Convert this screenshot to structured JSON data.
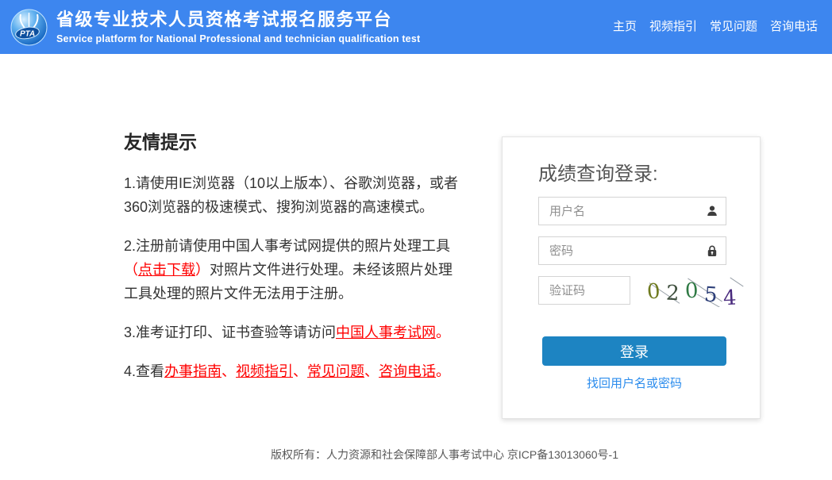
{
  "header": {
    "logo": "PTA",
    "title_cn": "省级专业技术人员资格考试报名服务平台",
    "title_en": "Service platform for National Professional and technician qualification test",
    "nav": [
      {
        "label": "主页"
      },
      {
        "label": "视频指引"
      },
      {
        "label": "常见问题"
      },
      {
        "label": "咨询电话"
      }
    ]
  },
  "tips": {
    "heading": "友情提示",
    "tip1": "1.请使用IE浏览器（10以上版本）、谷歌浏览器，或者360浏览器的极速模式、搜狗浏览器的高速模式。",
    "tip2": {
      "pre": "2.注册前请使用中国人事考试网提供的照片处理工具",
      "paren_open": "（",
      "link": "点击下载",
      "paren_close": "）",
      "post": "对照片文件进行处理。未经该照片处理工具处理的照片文件无法用于注册。"
    },
    "tip3": {
      "pre": "3.准考证打印、证书查验等请访问",
      "link": "中国人事考试网",
      "period": "。"
    },
    "tip4": {
      "pre": "4.查看",
      "links": [
        {
          "label": "办事指南"
        },
        {
          "label": "视频指引"
        },
        {
          "label": "常见问题"
        },
        {
          "label": "咨询电话"
        }
      ],
      "separator": "、",
      "period": "。"
    }
  },
  "login": {
    "title": "成绩查询登录:",
    "username_placeholder": "用户名",
    "password_placeholder": "密码",
    "captcha_placeholder": "验证码",
    "captcha_value": "02054",
    "captcha_digits": [
      {
        "char": "0",
        "color": "#6f7a1f"
      },
      {
        "char": "2",
        "color": "#40503f"
      },
      {
        "char": "0",
        "color": "#2f7a44"
      },
      {
        "char": "5",
        "color": "#2c3e78"
      },
      {
        "char": "4",
        "color": "#4a2b7e"
      }
    ],
    "button_label": "登录",
    "forgot_label": "找回用户名或密码"
  },
  "footer": {
    "copyright": "版权所有：人力资源和社会保障部人事考试中心 京ICP备13013060号-1"
  },
  "colors": {
    "header_blue": "#3d86ef",
    "button_blue": "#1d84c2",
    "link_red": "#ff0000",
    "link_blue": "#2b8ced"
  }
}
